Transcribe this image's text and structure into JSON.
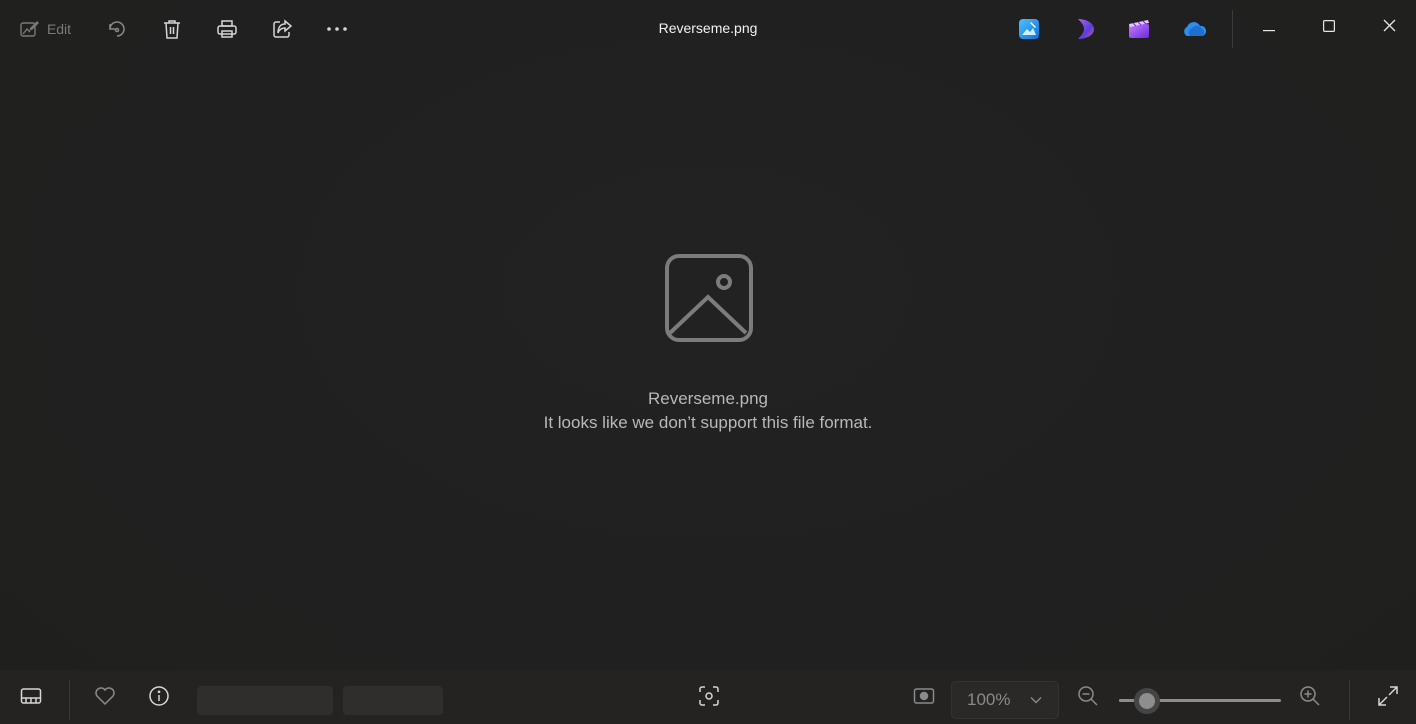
{
  "toolbar": {
    "edit_label": "Edit",
    "icons": [
      "edit-icon",
      "rotate-icon",
      "delete-icon",
      "print-icon",
      "share-icon",
      "more-icon"
    ]
  },
  "window": {
    "title": "Reverseme.png",
    "app_icons": [
      "photos-edit-app-icon",
      "designer-app-icon",
      "clipchamp-app-icon",
      "onedrive-icon"
    ],
    "controls": [
      "minimize-icon",
      "maximize-icon",
      "close-icon"
    ]
  },
  "content": {
    "file_name": "Reverseme.png",
    "message": "It looks like we don’t support this file format."
  },
  "bottombar": {
    "zoom_value": "100%",
    "zoom_fraction": 0.17,
    "icons": [
      "filmstrip-icon",
      "heart-icon",
      "info-icon",
      "focus-icon",
      "fit-screen-icon",
      "zoom-out-icon",
      "zoom-in-icon",
      "fullscreen-icon"
    ]
  },
  "colors": {
    "background": "#202020",
    "bottombar": "#242322",
    "text": "#b8b8b8"
  }
}
